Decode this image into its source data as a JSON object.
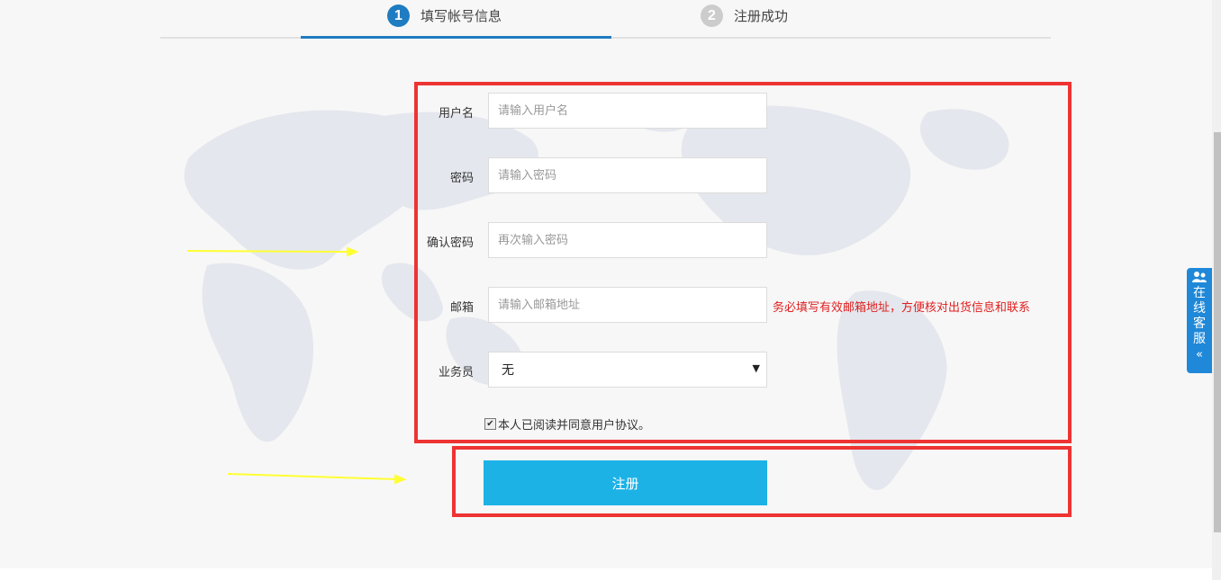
{
  "steps": [
    {
      "number": "1",
      "label": "填写帐号信息"
    },
    {
      "number": "2",
      "label": "注册成功"
    }
  ],
  "form": {
    "username": {
      "label": "用户名",
      "placeholder": "请输入用户名"
    },
    "password": {
      "label": "密码",
      "placeholder": "请输入密码"
    },
    "confirm": {
      "label": "确认密码",
      "placeholder": "再次输入密码"
    },
    "email": {
      "label": "邮箱",
      "placeholder": "请输入邮箱地址",
      "hint": "务必填写有效邮箱地址，方便核对出货信息和联系"
    },
    "salesperson": {
      "label": "业务员",
      "selected": "无"
    },
    "agreement": "本人已阅读并同意用户协议。",
    "submit": "注册"
  },
  "service": {
    "label": "在线客服",
    "collapse_icon": "«"
  },
  "colors": {
    "accent": "#1f7cc1",
    "button": "#1cb2e6",
    "annotation": "#ee3333",
    "hint": "#e02020"
  }
}
